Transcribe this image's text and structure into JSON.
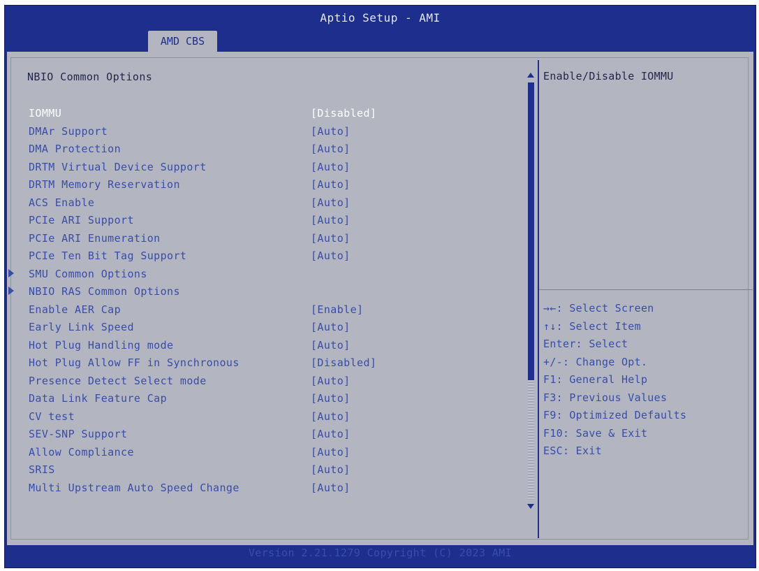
{
  "window": {
    "title": "Aptio Setup - AMI"
  },
  "tabs": [
    {
      "label": "AMD CBS",
      "active": true
    }
  ],
  "section_title": "NBIO Common Options",
  "settings": [
    {
      "label": "IOMMU",
      "value": "[Disabled]",
      "selected": true,
      "submenu": false
    },
    {
      "label": "DMAr Support",
      "value": "[Auto]",
      "submenu": false
    },
    {
      "label": "DMA Protection",
      "value": "[Auto]",
      "submenu": false
    },
    {
      "label": "DRTM Virtual Device Support",
      "value": "[Auto]",
      "submenu": false
    },
    {
      "label": "DRTM Memory Reservation",
      "value": "[Auto]",
      "submenu": false
    },
    {
      "label": "ACS Enable",
      "value": "[Auto]",
      "submenu": false
    },
    {
      "label": "PCIe ARI Support",
      "value": "[Auto]",
      "submenu": false
    },
    {
      "label": "PCIe ARI Enumeration",
      "value": "[Auto]",
      "submenu": false
    },
    {
      "label": "PCIe Ten Bit Tag Support",
      "value": "[Auto]",
      "submenu": false
    },
    {
      "label": "SMU Common Options",
      "value": "",
      "submenu": true
    },
    {
      "label": "NBIO RAS Common Options",
      "value": "",
      "submenu": true
    },
    {
      "label": "Enable AER Cap",
      "value": "[Enable]",
      "submenu": false
    },
    {
      "label": "Early Link Speed",
      "value": "[Auto]",
      "submenu": false
    },
    {
      "label": "Hot Plug Handling mode",
      "value": "[Auto]",
      "submenu": false
    },
    {
      "label": "Hot Plug Allow FF in Synchronous",
      "value": "[Disabled]",
      "submenu": false
    },
    {
      "label": "Presence Detect Select mode",
      "value": "[Auto]",
      "submenu": false
    },
    {
      "label": "Data Link Feature Cap",
      "value": "[Auto]",
      "submenu": false
    },
    {
      "label": "CV test",
      "value": "[Auto]",
      "submenu": false
    },
    {
      "label": "SEV-SNP Support",
      "value": "[Auto]",
      "submenu": false
    },
    {
      "label": "Allow Compliance",
      "value": "[Auto]",
      "submenu": false
    },
    {
      "label": "SRIS",
      "value": "[Auto]",
      "submenu": false
    },
    {
      "label": "Multi Upstream Auto Speed Change",
      "value": "[Auto]",
      "submenu": false
    }
  ],
  "help": {
    "text": "Enable/Disable IOMMU"
  },
  "key_help": [
    "→←: Select Screen",
    "↑↓: Select Item",
    "Enter: Select",
    "+/-: Change Opt.",
    "F1: General Help",
    "F3: Previous Values",
    "F9: Optimized Defaults",
    "F10: Save & Exit",
    "ESC: Exit"
  ],
  "footer": {
    "text": "Version 2.21.1279 Copyright (C) 2023 AMI"
  },
  "colors": {
    "frame_blue": "#1d2e8c",
    "panel_gray": "#b3b6c1",
    "item_text": "#384ca8",
    "selected_text": "#ffffff",
    "heading_text": "#21264a"
  }
}
